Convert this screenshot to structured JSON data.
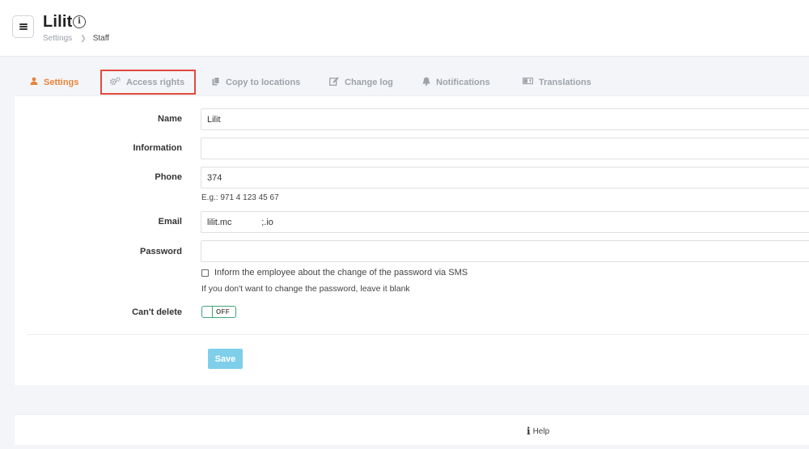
{
  "header": {
    "title": "Lilit",
    "breadcrumb": [
      "Settings",
      "Staff"
    ]
  },
  "tabs": [
    {
      "label": "Settings",
      "icon": "user-icon",
      "active": true
    },
    {
      "label": "Access rights",
      "icon": "gears-icon",
      "active": false
    },
    {
      "label": "Copy to locations",
      "icon": "copy-icon",
      "active": false
    },
    {
      "label": "Change log",
      "icon": "edit-icon",
      "active": false
    },
    {
      "label": "Notifications",
      "icon": "bell-icon",
      "active": false
    },
    {
      "label": "Translations",
      "icon": "translate-icon",
      "active": false
    }
  ],
  "form": {
    "name": {
      "label": "Name",
      "value": "Lilit"
    },
    "information": {
      "label": "Information",
      "value": ""
    },
    "phone": {
      "label": "Phone",
      "value": "374",
      "hint": "E.g.: 971 4 123 45 67"
    },
    "email": {
      "label": "Email",
      "value": "lilit.mc            ;.io"
    },
    "password": {
      "label": "Password",
      "value": "",
      "sms_checkbox_label": "Inform the employee about the change of the password via SMS",
      "hint": "If you don't want to change the password, leave it blank"
    },
    "cant_delete": {
      "label": "Can't delete",
      "toggle_state": "OFF"
    }
  },
  "actions": {
    "save_label": "Save"
  },
  "footer": {
    "help_label": "Help"
  },
  "colors": {
    "accent_orange": "#e8833a",
    "highlight_red": "#e34a3c",
    "toggle_green": "#3fa57a",
    "save_blue": "#7fcfea"
  }
}
